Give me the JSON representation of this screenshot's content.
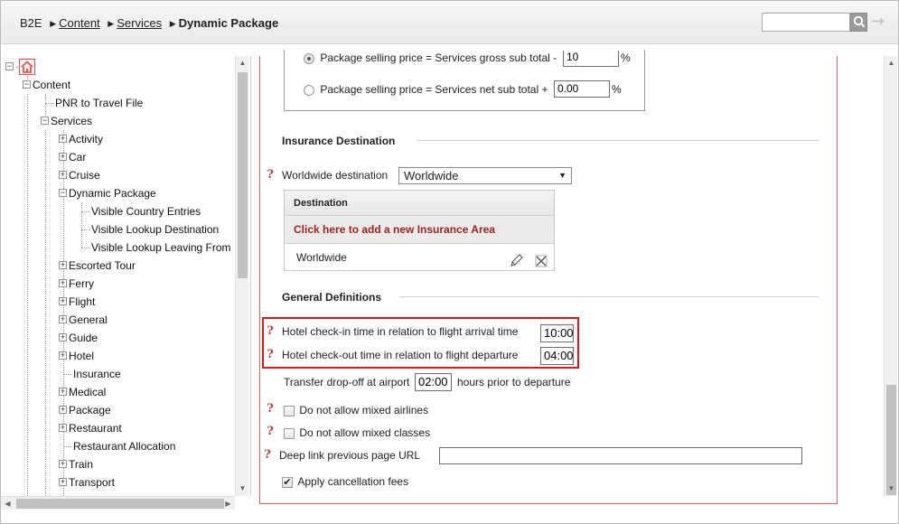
{
  "breadcrumb": {
    "root": "B2E",
    "separator": "▶",
    "items": [
      "Content",
      "Services"
    ],
    "current": "Dynamic Package"
  },
  "search": {
    "value": "",
    "placeholder": ""
  },
  "tree": {
    "root_label": "Content",
    "items": [
      {
        "label": "PNR to Travel File"
      },
      {
        "label": "Services"
      },
      {
        "label": "Activity"
      },
      {
        "label": "Car"
      },
      {
        "label": "Cruise"
      },
      {
        "label": "Dynamic Package"
      },
      {
        "label": "Visible Country Entries"
      },
      {
        "label": "Visible Lookup Destination"
      },
      {
        "label": "Visible Lookup Leaving From"
      },
      {
        "label": "Escorted Tour"
      },
      {
        "label": "Ferry"
      },
      {
        "label": "Flight"
      },
      {
        "label": "General"
      },
      {
        "label": "Guide"
      },
      {
        "label": "Hotel"
      },
      {
        "label": "Insurance"
      },
      {
        "label": "Medical"
      },
      {
        "label": "Package"
      },
      {
        "label": "Restaurant"
      },
      {
        "label": "Restaurant Allocation"
      },
      {
        "label": "Train"
      },
      {
        "label": "Transport"
      }
    ]
  },
  "pricing": {
    "gross_label": "Package selling price = Services gross sub total -",
    "gross_value": "10",
    "net_label": "Package selling price = Services net sub total +",
    "net_value": "0.00",
    "percent": "%"
  },
  "insurance": {
    "title": "Insurance Destination",
    "worldwide_label": "Worldwide destination",
    "worldwide_value": "Worldwide",
    "table_header": "Destination",
    "add_link": "Click here to add a new Insurance Area",
    "rows": [
      {
        "name": "Worldwide"
      }
    ]
  },
  "general": {
    "title": "General Definitions",
    "checkin_label": "Hotel check-in time in relation to flight arrival time",
    "checkin_value": "10:00",
    "checkout_label": "Hotel check-out time in relation to flight departure",
    "checkout_value": "04:00",
    "transfer_label": "Transfer drop-off at airport",
    "transfer_value": "02:00",
    "transfer_suffix": "hours prior to departure",
    "mixed_airlines": "Do not allow mixed airlines",
    "mixed_classes": "Do not allow mixed classes",
    "deeplink_label": "Deep link previous page URL",
    "deeplink_value": "",
    "cancellation_fees": "Apply cancellation fees",
    "cancellation_checked": true
  },
  "colors": {
    "accent_red": "#d51c1c",
    "link_red": "#9e2222",
    "help_icon": "#c23b3b"
  },
  "icons": {
    "search": "search-icon",
    "go": "arrow-right-icon",
    "home": "home-icon",
    "help": "help-icon",
    "edit": "pencil-icon",
    "delete": "close-icon"
  }
}
